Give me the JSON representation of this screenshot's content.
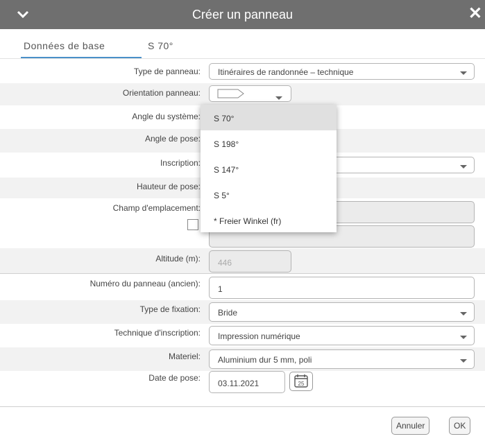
{
  "dialog": {
    "title": "Créer un panneau"
  },
  "tabs": [
    {
      "label": "Données de base",
      "active": true
    },
    {
      "label": "S 70°",
      "active": false
    }
  ],
  "form": {
    "type_panneau": {
      "label": "Type de panneau:",
      "value": "Itinéraires de randonnée – technique"
    },
    "orientation": {
      "label": "Orientation panneau:"
    },
    "angle_systeme": {
      "label": "Angle du système:"
    },
    "angle_pose": {
      "label": "Angle de pose:"
    },
    "inscription": {
      "label": "Inscription:"
    },
    "hauteur_pose": {
      "label": "Hauteur de pose:"
    },
    "champ_emplacement": {
      "label": "Champ d'emplacement:"
    },
    "altitude": {
      "label": "Altitude (m):",
      "value": "446"
    },
    "numero_panneau": {
      "label": "Numéro du panneau (ancien):",
      "value": "1"
    },
    "type_fixation": {
      "label": "Type de fixation:",
      "value": "Bride"
    },
    "technique_inscription": {
      "label": "Technique d'inscription:",
      "value": "Impression numérique"
    },
    "materiel": {
      "label": "Materiel:",
      "value": "Aluminium dur 5 mm, poli"
    },
    "date_pose": {
      "label": "Date de pose:",
      "value": "03.11.2021",
      "calendar_day": "25"
    }
  },
  "dropdown": {
    "options": [
      "S 70°",
      "S 198°",
      "S 147°",
      "S 5°",
      "* Freier Winkel (fr)"
    ],
    "selected": "S 70°"
  },
  "buttons": {
    "cancel": "Annuler",
    "ok": "OK"
  },
  "icons": {
    "collapse": "chevron-down-icon",
    "close": "close-icon",
    "calendar": "calendar-icon"
  }
}
